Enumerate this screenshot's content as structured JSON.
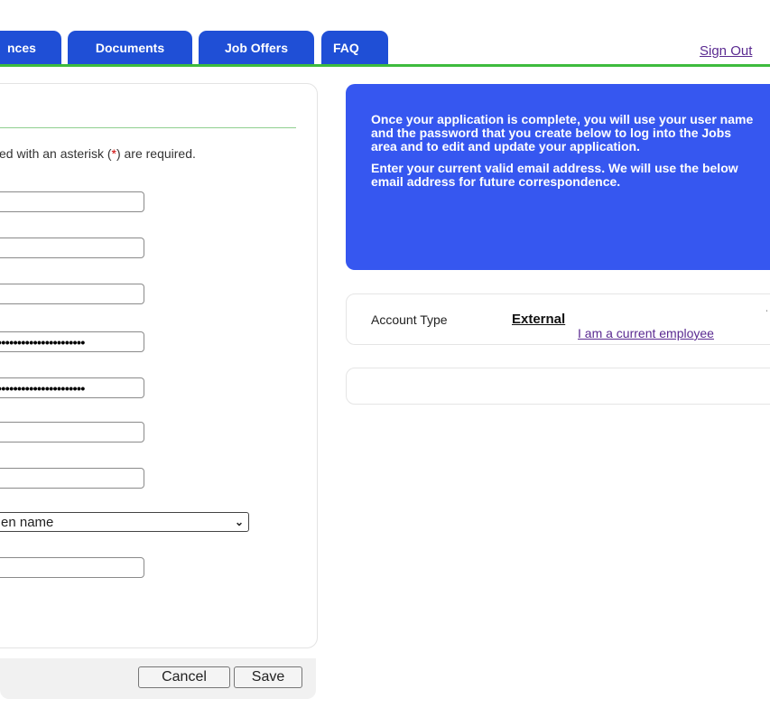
{
  "tabs": [
    {
      "label": "nces"
    },
    {
      "label": "Documents"
    },
    {
      "label": "Job Offers"
    },
    {
      "label": "FAQ"
    }
  ],
  "sign_out": "Sign Out",
  "form": {
    "required_note_prefix": "ed with an asterisk (",
    "required_note_asterisk": "*",
    "required_note_suffix": ") are required.",
    "fields": [
      {
        "value": ""
      },
      {
        "value": ""
      },
      {
        "value": ""
      },
      {
        "value": "••••••••••••••••••••••"
      },
      {
        "value": "••••••••••••••••••••••"
      },
      {
        "value": ""
      },
      {
        "value": ""
      }
    ],
    "select_value": "en name",
    "last_field_value": "",
    "cancel_label": "Cancel",
    "save_label": "Save"
  },
  "info": {
    "paragraph_1": "Once your application is complete, you will use your user name and the password that you create below to log into the Jobs area and to edit and update your application.",
    "paragraph_2": "Enter your current valid email address. We will use the below email address for future correspondence."
  },
  "account": {
    "label": "Account Type",
    "value": "External",
    "link": "I am a current employee"
  },
  "colors": {
    "tab_blue": "#1f4fd6",
    "info_blue": "#3657f0",
    "accent_green": "#3dbb3d",
    "link_purple": "#5a2a91"
  }
}
